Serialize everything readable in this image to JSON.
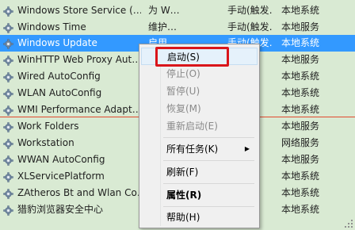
{
  "services": [
    {
      "name": "Windows Store Service (…",
      "description": "为 W…",
      "status": "",
      "startup": "手动(触发…",
      "logon": "本地系统"
    },
    {
      "name": "Windows Time",
      "description": "维护…",
      "status": "",
      "startup": "手动(触发…",
      "logon": "本地服务"
    },
    {
      "name": "Windows Update",
      "description": "启用…",
      "status": "",
      "startup": "手动(触发…",
      "logon": "本地系统",
      "selected": true
    },
    {
      "name": "WinHTTP Web Proxy Aut…",
      "description": "",
      "status": "",
      "startup": "",
      "logon": "本地服务"
    },
    {
      "name": "Wired AutoConfig",
      "description": "",
      "status": "",
      "startup": "",
      "logon": "本地系统"
    },
    {
      "name": "WLAN AutoConfig",
      "description": "",
      "status": "",
      "startup": "",
      "logon": "本地系统"
    },
    {
      "name": "WMI Performance Adapt…",
      "description": "",
      "status": "",
      "startup": "",
      "logon": "本地系统"
    },
    {
      "name": "Work Folders",
      "description": "",
      "status": "",
      "startup": "",
      "logon": "本地服务"
    },
    {
      "name": "Workstation",
      "description": "",
      "status": "",
      "startup": "",
      "logon": "网络服务"
    },
    {
      "name": "WWAN AutoConfig",
      "description": "",
      "status": "",
      "startup": "",
      "logon": "本地服务"
    },
    {
      "name": "XLServicePlatform",
      "description": "",
      "status": "",
      "startup": "",
      "logon": "本地系统"
    },
    {
      "name": "ZAtheros Bt and Wlan Co…",
      "description": "",
      "status": "",
      "startup": "",
      "logon": "本地系统"
    },
    {
      "name": "猎豹浏览器安全中心",
      "description": "",
      "status": "",
      "startup": "",
      "logon": "本地系统"
    }
  ],
  "context_menu": {
    "items": [
      {
        "label": "启动(S)",
        "enabled": true
      },
      {
        "label": "停止(O)",
        "enabled": false
      },
      {
        "label": "暂停(U)",
        "enabled": false
      },
      {
        "label": "恢复(M)",
        "enabled": false
      },
      {
        "label": "重新启动(E)",
        "enabled": false
      },
      {
        "label": "所有任务(K)",
        "enabled": true,
        "submenu": true
      },
      {
        "label": "刷新(F)",
        "enabled": true
      },
      {
        "label": "属性(R)",
        "enabled": true,
        "bold": true
      },
      {
        "label": "帮助(H)",
        "enabled": true
      }
    ]
  },
  "colors": {
    "list_background": "#d9ead3",
    "selection": "#3399ff",
    "highlight_box": "#d9151b",
    "divider_line": "#e2492f"
  },
  "icons": {
    "service": "gear-icon",
    "submenu": "triangle-right-icon",
    "resize": "size-grip-icon"
  }
}
